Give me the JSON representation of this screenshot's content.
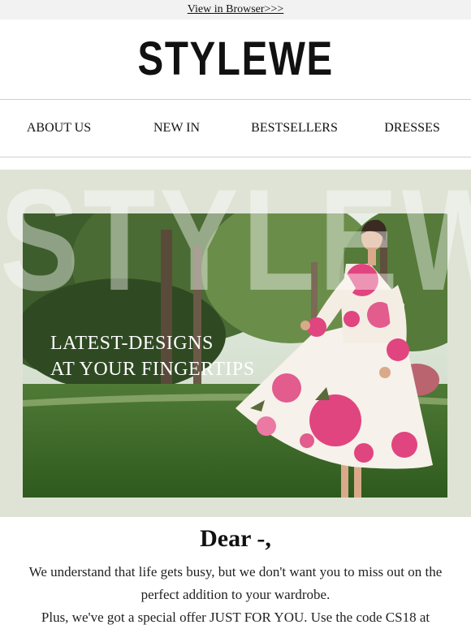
{
  "topbar": {
    "view_in_browser": "View in Browser>>>"
  },
  "brand": {
    "logo_text": "STYLEWE"
  },
  "nav": {
    "items": [
      {
        "label": "ABOUT US"
      },
      {
        "label": "NEW IN"
      },
      {
        "label": "BESTSELLERS"
      },
      {
        "label": "DRESSES"
      }
    ]
  },
  "hero": {
    "watermark": "STYLEWE",
    "caption_line1": "LATEST-DESIGNS",
    "caption_line2": "AT YOUR FINGERTIPS"
  },
  "message": {
    "greeting": "Dear -,",
    "paragraph1": "We understand that life gets busy, but we don't want you to miss out on the perfect addition to your wardrobe.",
    "paragraph2": "Plus, we've got a special offer JUST FOR YOU. Use the code CS18 at"
  },
  "colors": {
    "hero_background": "#dfe3d6",
    "topbar_background": "#f2f2f2",
    "dress_pink": "#e0457f"
  }
}
